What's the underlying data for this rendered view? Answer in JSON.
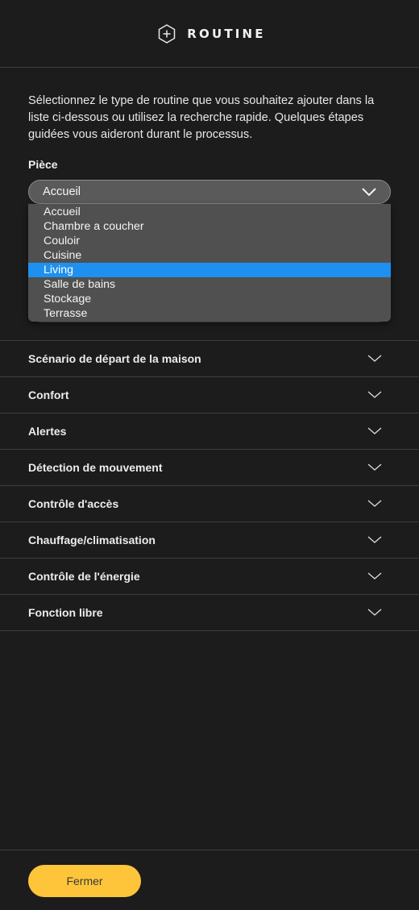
{
  "header": {
    "title": "ROUTINE",
    "icon": "hexagon-plus-icon"
  },
  "intro": {
    "text": "Sélectionnez le type de routine que vous souhaitez ajouter dans la liste ci-dessous ou utilisez la recherche rapide. Quelques étapes guidées vous aideront durant le processus."
  },
  "room": {
    "label": "Pièce",
    "selected_value": "Accueil",
    "options": [
      "Accueil",
      "Chambre a coucher",
      "Couloir",
      "Cuisine",
      "Living",
      "Salle de bains",
      "Stockage",
      "Terrasse"
    ],
    "highlighted": "Living"
  },
  "categories": [
    {
      "label": "Scénario de départ de la maison"
    },
    {
      "label": "Confort"
    },
    {
      "label": "Alertes"
    },
    {
      "label": "Détection de mouvement"
    },
    {
      "label": "Contrôle d'accès"
    },
    {
      "label": "Chauffage/climatisation"
    },
    {
      "label": "Contrôle de l'énergie"
    },
    {
      "label": "Fonction libre"
    }
  ],
  "footer": {
    "close_label": "Fermer"
  },
  "colors": {
    "accent": "#ffc53a",
    "highlight": "#1e90f0",
    "background": "#1c1c1c"
  }
}
